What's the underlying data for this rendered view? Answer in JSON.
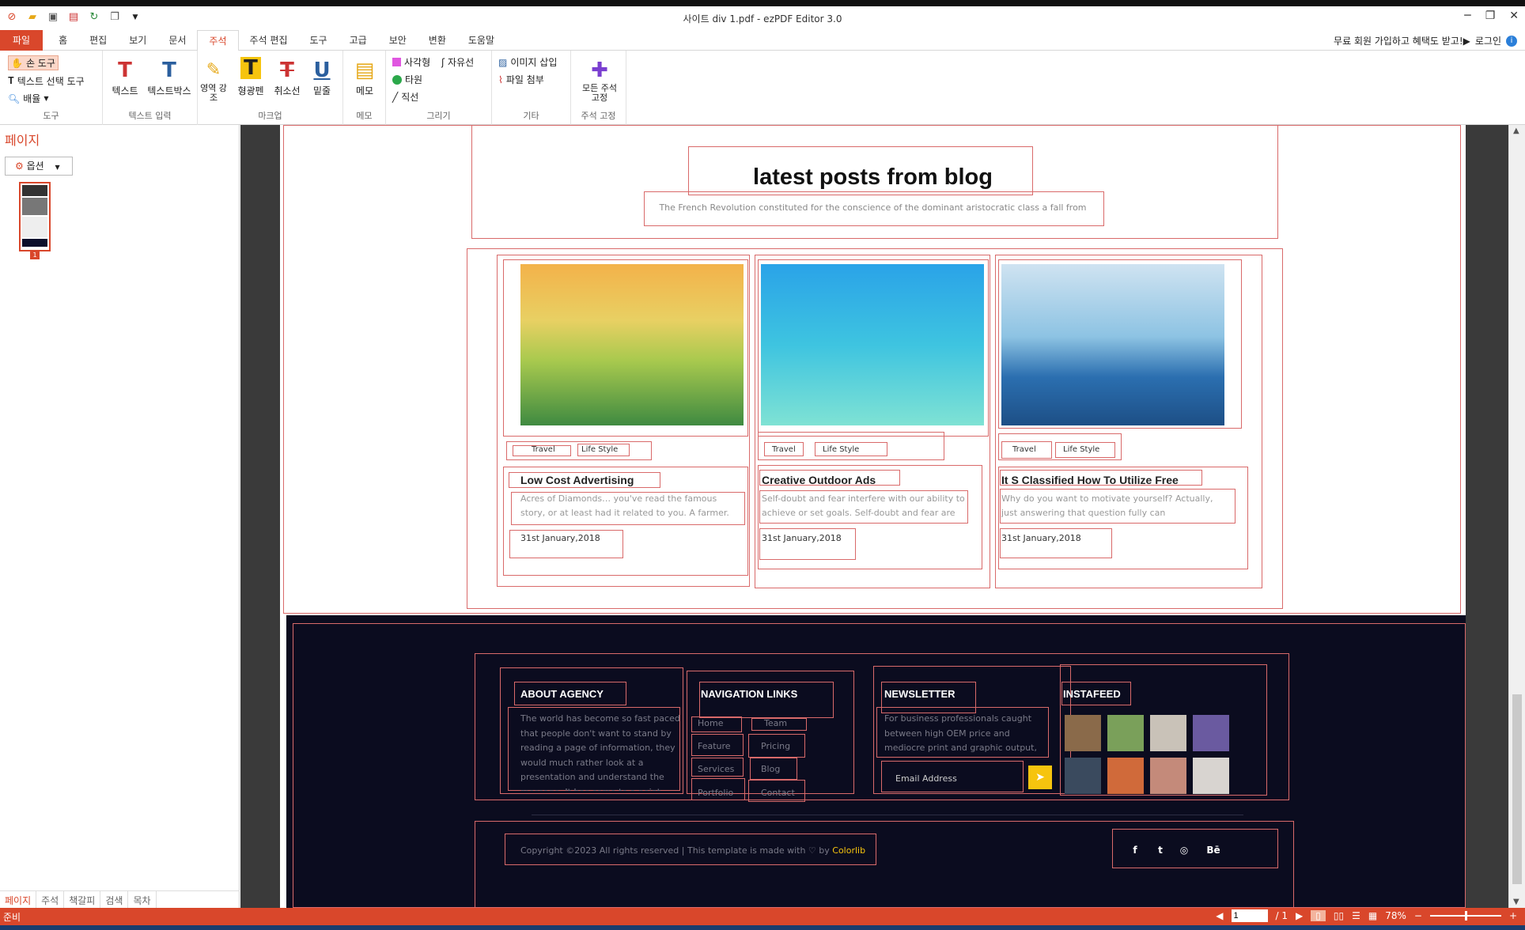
{
  "window": {
    "title": "사이트 div 1.pdf - ezPDF Editor 3.0",
    "minimize": "─",
    "restore": "❐",
    "close": "✕"
  },
  "tabs": [
    "파일",
    "홈",
    "편집",
    "보기",
    "문서",
    "주석",
    "주석 편집",
    "도구",
    "고급",
    "보안",
    "변환",
    "도움말"
  ],
  "active_tab": "주석",
  "promo": {
    "text": "무료 회원 가입하고 혜택도 받고!▶",
    "login": "로그인"
  },
  "ribbon": {
    "tools": {
      "hand": "손 도구",
      "text_select": "텍스트 선택 도구",
      "zoom": "배율",
      "label": "도구"
    },
    "text_input": {
      "text": "텍스트",
      "textbox": "텍스트박스",
      "label": "텍스트 입력"
    },
    "markup": {
      "area": "영역 강조",
      "highlight": "형광펜",
      "strike": "취소선",
      "underline": "밑줄",
      "label": "마크업"
    },
    "memo": {
      "memo": "메모",
      "label": "메모"
    },
    "draw": {
      "rect": "사각형",
      "free": "자유선",
      "ellipse": "타원",
      "line": "직선",
      "label": "그리기"
    },
    "etc": {
      "image": "이미지 삽입",
      "attach": "파일 첨부",
      "label": "기타"
    },
    "fix": {
      "all": "모든 주석 고정",
      "label": "주석 고정"
    }
  },
  "sidebar": {
    "title": "페이지",
    "options": "옵션",
    "page_num": "1",
    "tabs": [
      "페이지",
      "주석",
      "책갈피",
      "검색",
      "목차"
    ]
  },
  "doc": {
    "blog_title": "latest posts from blog",
    "blog_subtitle": "The French Revolution constituted for the conscience of the dominant aristocratic class a fall from",
    "cards": [
      {
        "tag1": "Travel",
        "tag2": "Life Style",
        "title": "Low Cost Advertising",
        "body": "Acres of Diamonds… you've read the famous story, or at least had it related to you. A farmer.",
        "date": "31st January,2018"
      },
      {
        "tag1": "Travel",
        "tag2": "Life Style",
        "title": "Creative Outdoor Ads",
        "body": "Self-doubt and fear interfere with our ability to achieve or set goals. Self-doubt and fear are",
        "date": "31st January,2018"
      },
      {
        "tag1": "Travel",
        "tag2": "Life Style",
        "title": "It S Classified How To Utilize Free",
        "body": "Why do you want to motivate yourself? Actually, just answering that question fully can",
        "date": "31st January,2018"
      }
    ],
    "footer": {
      "about_title": "ABOUT AGENCY",
      "about_body": "The world has become so fast paced that people don't want to stand by reading a page of information, they would much rather look at a presentation and understand the message. It has come to a point",
      "nav_title": "NAVIGATION LINKS",
      "nav_links": [
        "Home",
        "Team",
        "Feature",
        "Pricing",
        "Services",
        "Blog",
        "Portfolio",
        "Contact"
      ],
      "news_title": "NEWSLETTER",
      "news_body": "For business professionals caught between high OEM price and mediocre print and graphic output,",
      "email_placeholder": "Email Address",
      "insta_title": "INSTAFEED",
      "copyright": "Copyright ©2023 All rights reserved | This template is made with ♡ by ",
      "brand": "Colorlib",
      "social": [
        "f",
        "t",
        "◎",
        "Bē"
      ]
    }
  },
  "status": {
    "left": "준비",
    "page_input": "1",
    "page_total": "/ 1",
    "zoom": "78%"
  },
  "colors": {
    "accent": "#d9472b",
    "footer_bg": "#0b0c1f",
    "yellow": "#f6c40e"
  }
}
